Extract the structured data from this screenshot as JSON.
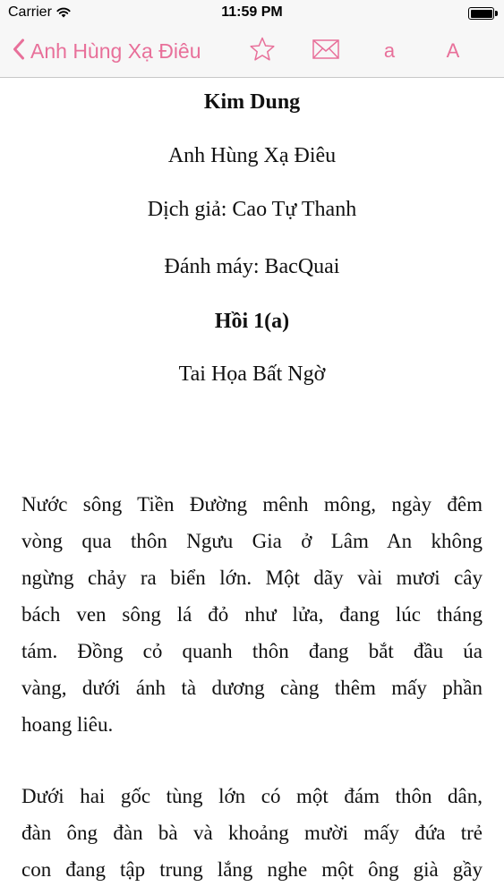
{
  "status_bar": {
    "carrier": "Carrier",
    "time": "11:59 PM",
    "battery_level": 1.0
  },
  "nav": {
    "back_label": "Anh Hùng Xạ Điêu",
    "font_small": "a",
    "font_large": "A",
    "accent_color": "#e8709a",
    "icons": [
      "chevron-left-icon",
      "star-icon",
      "envelope-icon"
    ]
  },
  "book": {
    "author": "Kim Dung",
    "title": "Anh Hùng Xạ Điêu",
    "translator": "Dịch giả: Cao Tự Thanh",
    "typist": "Đánh máy: BacQuai",
    "chapter": "Hồi 1(a)",
    "chapter_title": "Tai Họa Bất Ngờ"
  },
  "paragraphs": [
    {
      "lines": [
        "Nước sông Tiền Đường mênh mông, ngày đêm",
        "vòng qua thôn Ngưu Gia ở Lâm An không",
        "ngừng chảy ra biển lớn. Một dãy vài mươi cây",
        "bách ven sông lá đỏ như lửa, đang lúc tháng",
        "tám. Đồng cỏ quanh thôn đang bắt đầu úa",
        "vàng, dưới ánh tà dương càng thêm mấy phần",
        "hoang liêu."
      ]
    },
    {
      "lines": [
        "Dưới hai gốc tùng lớn có một đám thôn dân,",
        "đàn ông đàn bà và khoảng mười mấy đứa trẻ",
        "con đang tập trung lắng nghe một ông già gầy"
      ]
    }
  ]
}
